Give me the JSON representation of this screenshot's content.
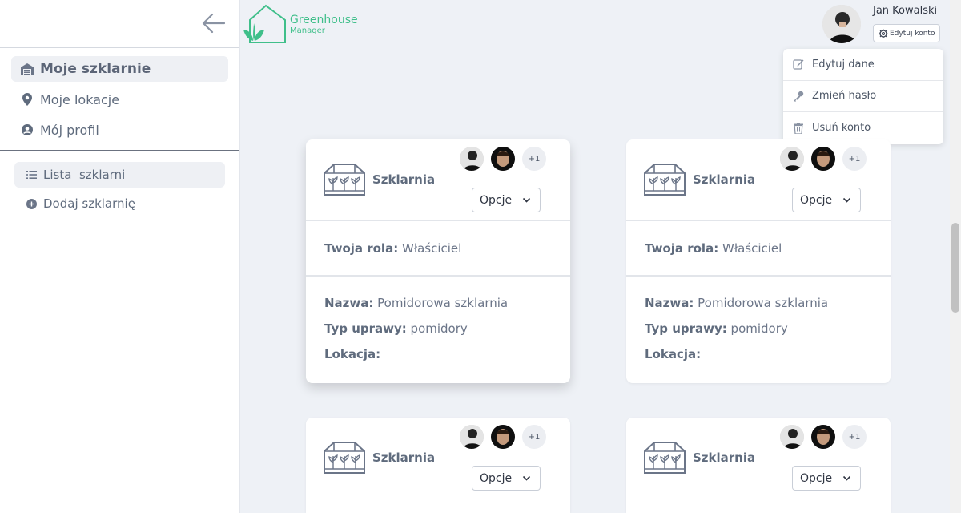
{
  "sidebar": {
    "main_items": [
      {
        "label": "Moje szklarnie",
        "icon": "warehouse-icon"
      },
      {
        "label": "Moje lokacje",
        "icon": "map-pin-icon"
      },
      {
        "label": "Mój profil",
        "icon": "user-circle-icon"
      }
    ],
    "sub_items": [
      {
        "label": "Lista  szklarni",
        "icon": "list-icon"
      },
      {
        "label": "Dodaj szklarnię",
        "icon": "plus-circle-icon"
      }
    ]
  },
  "header": {
    "logo_title": "Greenhouse",
    "logo_sub": "Manager",
    "user_name": "Jan Kowalski",
    "edit_account_label": "Edytuj konto"
  },
  "dropdown": {
    "items": [
      {
        "label": "Edytuj dane",
        "icon": "edit-icon"
      },
      {
        "label": "Zmień hasło",
        "icon": "key-icon"
      },
      {
        "label": "Usuń konto",
        "icon": "trash-icon"
      }
    ]
  },
  "cards": [
    {
      "title": "Szklarnia",
      "more_count": "+1",
      "options_label": "Opcje",
      "role_label": "Twoja rola:",
      "role_value": "Właściciel",
      "name_label": "Nazwa:",
      "name_value": "Pomidorowa szklarnia",
      "type_label": "Typ uprawy:",
      "type_value": "pomidory",
      "location_label": "Lokacja:",
      "location_value": ""
    },
    {
      "title": "Szklarnia",
      "more_count": "+1",
      "options_label": "Opcje",
      "role_label": "Twoja rola:",
      "role_value": "Właściciel",
      "name_label": "Nazwa:",
      "name_value": "Pomidorowa szklarnia",
      "type_label": "Typ uprawy:",
      "type_value": "pomidory",
      "location_label": "Lokacja:",
      "location_value": ""
    },
    {
      "title": "Szklarnia",
      "more_count": "+1",
      "options_label": "Opcje"
    },
    {
      "title": "Szklarnia",
      "more_count": "+1",
      "options_label": "Opcje"
    }
  ],
  "colors": {
    "brand": "#3fbf8a",
    "background": "#eef1f6",
    "text": "#5f6b7d"
  }
}
